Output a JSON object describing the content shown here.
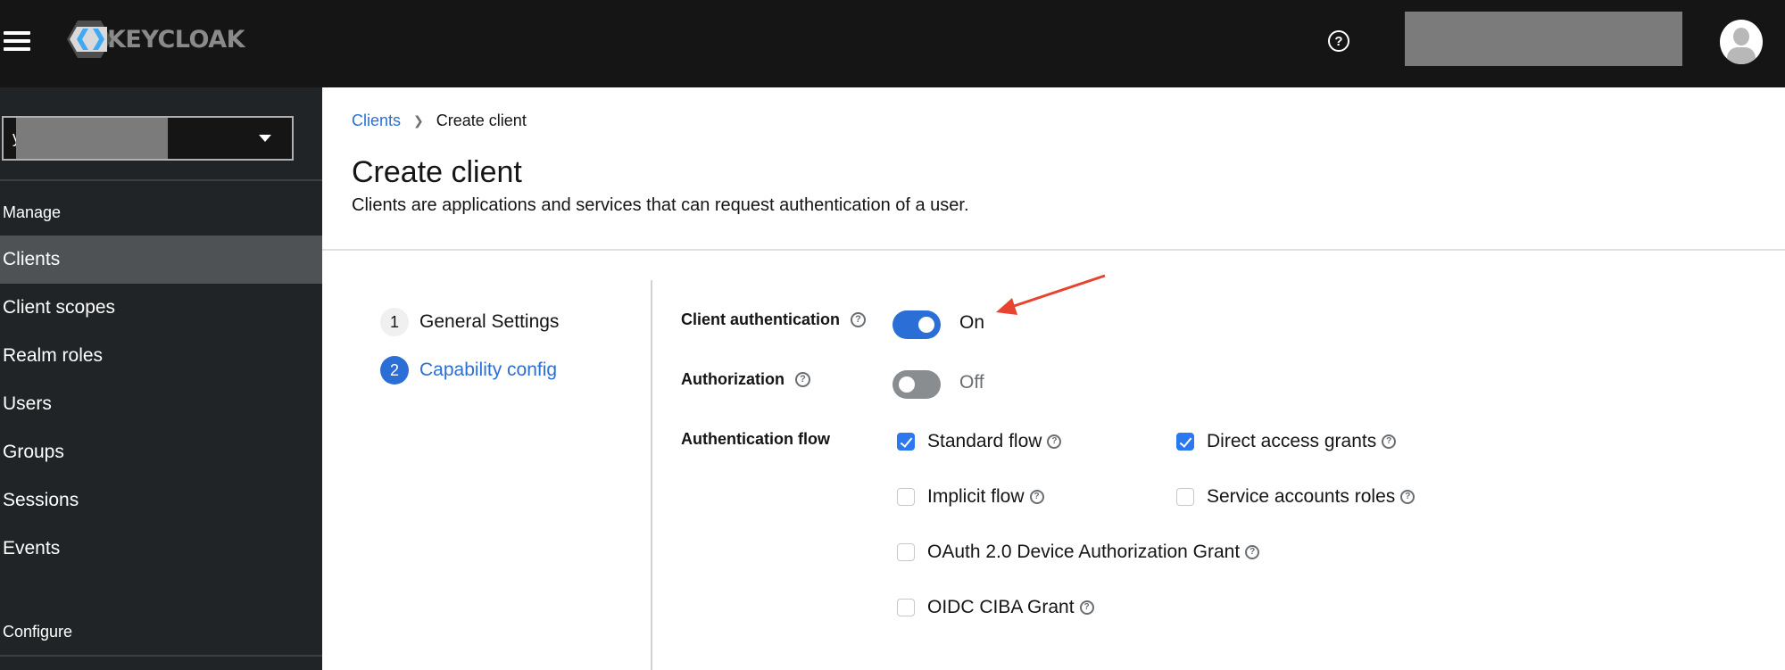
{
  "header": {
    "brand": "KEYCLOAK",
    "help_icon": "question-circle-icon",
    "user_menu_label": "",
    "avatar_icon": "user-avatar-icon",
    "menu_icon": "hamburger-icon"
  },
  "sidebar": {
    "realm_selector": {
      "value_initial": "y",
      "value_redacted": true,
      "caret_icon": "caret-down-icon"
    },
    "sections": [
      {
        "label": "Manage"
      },
      {
        "label": "Configure"
      }
    ],
    "items": [
      {
        "label": "Clients",
        "active": true
      },
      {
        "label": "Client scopes",
        "active": false
      },
      {
        "label": "Realm roles",
        "active": false
      },
      {
        "label": "Users",
        "active": false
      },
      {
        "label": "Groups",
        "active": false
      },
      {
        "label": "Sessions",
        "active": false
      },
      {
        "label": "Events",
        "active": false
      }
    ]
  },
  "breadcrumb": {
    "items": [
      {
        "label": "Clients",
        "link": true
      },
      {
        "label": "Create client",
        "link": false
      }
    ],
    "separator_icon": "angle-right-icon"
  },
  "page": {
    "title": "Create client",
    "description": "Clients are applications and services that can request authentication of a user."
  },
  "wizard": {
    "steps": [
      {
        "number": "1",
        "label": "General Settings",
        "state": "done"
      },
      {
        "number": "2",
        "label": "Capability config",
        "state": "current"
      }
    ]
  },
  "form": {
    "client_authentication": {
      "label": "Client authentication",
      "value": true,
      "state_text": "On"
    },
    "authorization": {
      "label": "Authorization",
      "value": false,
      "state_text": "Off"
    },
    "authentication_flow": {
      "label": "Authentication flow",
      "options": [
        {
          "label": "Standard flow",
          "checked": true
        },
        {
          "label": "Direct access grants",
          "checked": true
        },
        {
          "label": "Implicit flow",
          "checked": false
        },
        {
          "label": "Service accounts roles",
          "checked": false
        },
        {
          "label": "OAuth 2.0 Device Authorization Grant",
          "checked": false
        },
        {
          "label": "OIDC CIBA Grant",
          "checked": false
        }
      ]
    },
    "help_glyph": "?"
  },
  "annotation": {
    "type": "arrow",
    "color": "#e8432e",
    "points_to": "client-authentication-state"
  },
  "colors": {
    "accent": "#2b6fd6",
    "masthead": "#151515",
    "sidebar": "#212427",
    "sidebar_active": "#4f5255"
  }
}
